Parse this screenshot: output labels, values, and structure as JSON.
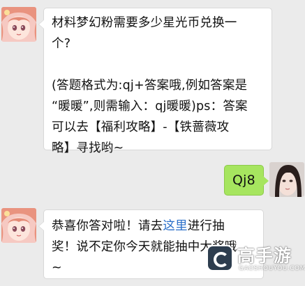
{
  "messages": [
    {
      "sender": "bot",
      "lines": [
        "材料梦幻粉需要多少星光币兑换一",
        "个?",
        "",
        "(答题格式为:qj+答案哦,例如答案是",
        "“暖暖”,则需输入：qj暖暖)ps：答案",
        "可以去【福利攻略】-【铁蔷薇攻",
        "略】寻找哟~"
      ]
    },
    {
      "sender": "user",
      "text": "Qj8"
    },
    {
      "sender": "bot",
      "line1_before": "恭喜你答对啦！请去",
      "line1_link": "这里",
      "line1_after": "进行抽",
      "line2": "奖！说不定你今天就能抽中大奖哦",
      "line3": "~"
    }
  ],
  "watermark": {
    "title": "高手游",
    "subtitle": "GAOSHOUYOU.COM"
  },
  "colors": {
    "background": "#ebebeb",
    "incoming_bubble": "#ffffff",
    "outgoing_bubble": "#a6e55f",
    "link": "#2b6fc9"
  }
}
